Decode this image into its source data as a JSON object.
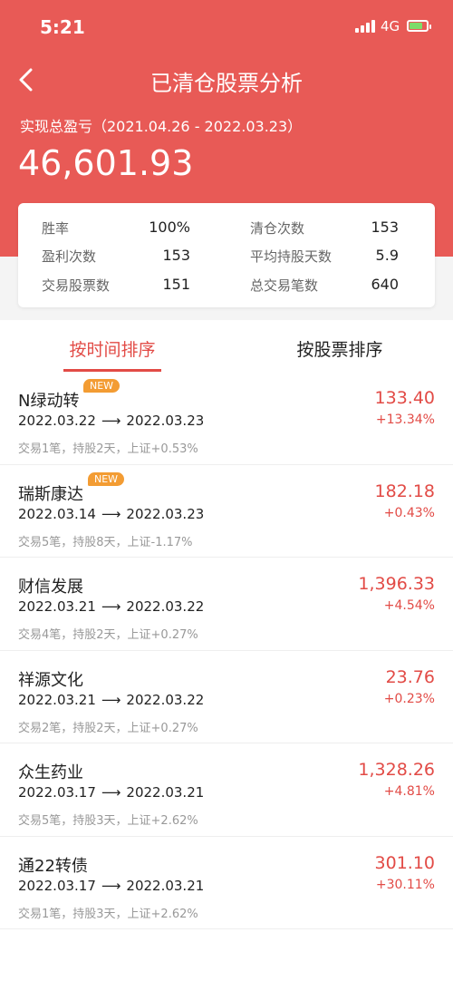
{
  "status_bar": {
    "time": "5:21",
    "network": "4G"
  },
  "nav": {
    "title": "已清仓股票分析",
    "back_icon": "chevron-left-icon"
  },
  "summary": {
    "label": "实现总盈亏（2021.04.26 - 2022.03.23）",
    "value": "46,601.93"
  },
  "stats": [
    {
      "label": "胜率",
      "value": "100%"
    },
    {
      "label": "清仓次数",
      "value": "153"
    },
    {
      "label": "盈利次数",
      "value": "153"
    },
    {
      "label": "平均持股天数",
      "value": "5.9"
    },
    {
      "label": "交易股票数",
      "value": "151"
    },
    {
      "label": "总交易笔数",
      "value": "640"
    }
  ],
  "tabs": [
    {
      "label": "按时间排序",
      "active": true
    },
    {
      "label": "按股票排序",
      "active": false
    }
  ],
  "items": [
    {
      "name": "N绿动转",
      "badge": "NEW",
      "start": "2022.03.22",
      "end": "2022.03.23",
      "detail": "交易1笔，持股2天，上证+0.53%",
      "amount": "133.40",
      "pct": "+13.34%"
    },
    {
      "name": "瑞斯康达",
      "badge": "NEW",
      "start": "2022.03.14",
      "end": "2022.03.23",
      "detail": "交易5笔，持股8天，上证-1.17%",
      "amount": "182.18",
      "pct": "+0.43%"
    },
    {
      "name": "财信发展",
      "badge": "",
      "start": "2022.03.21",
      "end": "2022.03.22",
      "detail": "交易4笔，持股2天，上证+0.27%",
      "amount": "1,396.33",
      "pct": "+4.54%"
    },
    {
      "name": "祥源文化",
      "badge": "",
      "start": "2022.03.21",
      "end": "2022.03.22",
      "detail": "交易2笔，持股2天，上证+0.27%",
      "amount": "23.76",
      "pct": "+0.23%"
    },
    {
      "name": "众生药业",
      "badge": "",
      "start": "2022.03.17",
      "end": "2022.03.21",
      "detail": "交易5笔，持股3天，上证+2.62%",
      "amount": "1,328.26",
      "pct": "+4.81%"
    },
    {
      "name": "通22转债",
      "badge": "",
      "start": "2022.03.17",
      "end": "2022.03.21",
      "detail": "交易1笔，持股3天，上证+2.62%",
      "amount": "301.10",
      "pct": "+30.11%"
    }
  ],
  "colors": {
    "header": "#e85a56",
    "accent": "#e24b46",
    "badge": "#f39c33"
  }
}
